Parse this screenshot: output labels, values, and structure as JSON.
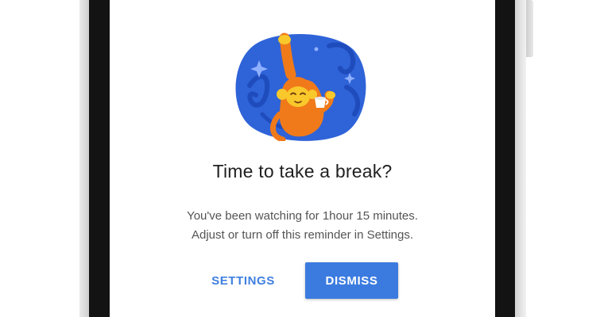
{
  "dialog": {
    "illustration": "monkey-drinking-tea-illustration",
    "title": "Time to take a break?",
    "body_line_1": "You've been watching for 1hour 15 minutes.",
    "body_line_2": "Adjust or turn off this reminder in Settings.",
    "settings_label": "SETTINGS",
    "dismiss_label": "DISMISS"
  },
  "colors": {
    "accent": "#3b7be0",
    "illustration_bg": "#2f63d8",
    "monkey": "#f07a1a",
    "monkey_face": "#f9c82b"
  }
}
